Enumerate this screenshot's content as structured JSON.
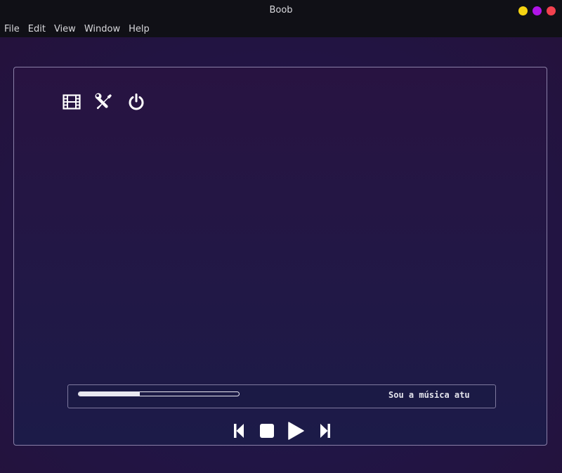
{
  "window": {
    "title": "Boob",
    "buttons": [
      {
        "name": "minimize",
        "color": "#f5d312"
      },
      {
        "name": "maximize",
        "color": "#b014e8"
      },
      {
        "name": "close",
        "color": "#f2414e"
      }
    ]
  },
  "menu": {
    "items": [
      "File",
      "Edit",
      "View",
      "Window",
      "Help"
    ]
  },
  "toolbar": {
    "icons": [
      "film-icon",
      "tools-icon",
      "power-icon"
    ]
  },
  "player": {
    "progress": 0.38,
    "track_title": "Sou a música atual"
  },
  "controls": {
    "icons": [
      "skip-previous-icon",
      "stop-icon",
      "play-icon",
      "skip-next-icon"
    ]
  },
  "colors": {
    "background": "#1c1432",
    "accent": "#e8e8f0",
    "panel_border": "#8a80a8"
  }
}
